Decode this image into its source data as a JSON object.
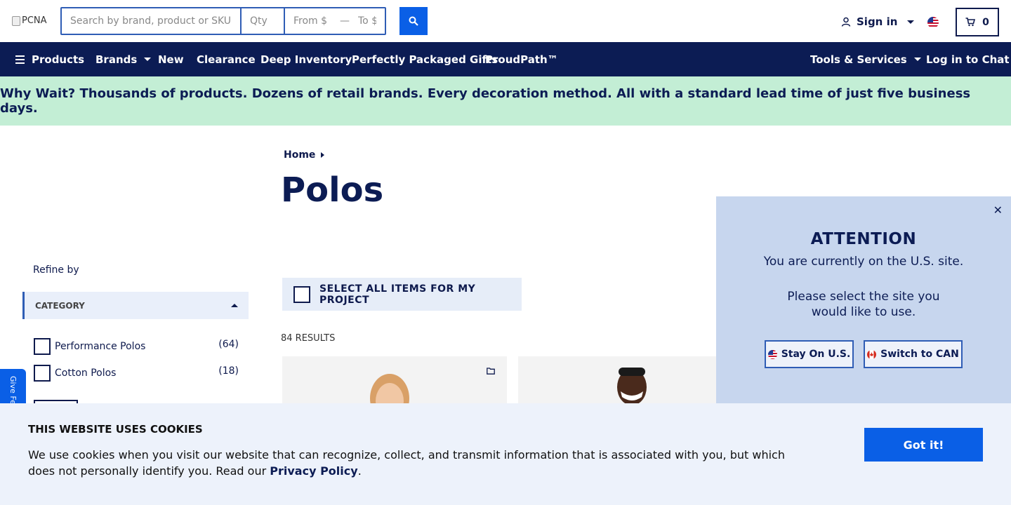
{
  "header": {
    "logo_alt": "PCNA",
    "search": {
      "placeholder": "Search by brand, product or SKU",
      "qty_placeholder": "Qty",
      "from_placeholder": "From $",
      "to_placeholder": "To $"
    },
    "signin_label": "Sign in",
    "cart_count": "0"
  },
  "nav": {
    "products": "Products",
    "brands": "Brands",
    "new": "New",
    "clearance": "Clearance",
    "deep_inventory": "Deep Inventory",
    "gifts": "Perfectly Packaged Gifts",
    "proudpath": "ProudPath™",
    "tools": "Tools & Services",
    "chat": "Log in to Chat"
  },
  "banner": {
    "text": "Why Wait? Thousands of products. Dozens of retail brands. Every decoration method. All with a standard lead time of just five business days."
  },
  "breadcrumb": {
    "home": "Home"
  },
  "page": {
    "title": "Polos",
    "results": "84 RESULTS",
    "select_all": "SELECT ALL ITEMS FOR MY PROJECT"
  },
  "filters": {
    "refine_label": "Refine by",
    "category_label": "CATEGORY",
    "items": [
      {
        "label": "Performance Polos",
        "count": "(64)"
      },
      {
        "label": "Cotton Polos",
        "count": "(18)"
      }
    ]
  },
  "feedback": {
    "label": "Give Fe"
  },
  "modal": {
    "title": "ATTENTION",
    "subtitle": "You are currently on the U.S. site.",
    "ask": "Please select the site you would like to use.",
    "stay_label": "Stay On U.S.",
    "switch_label": "Switch to CAN"
  },
  "cookie": {
    "title": "THIS WEBSITE USES COOKIES",
    "text": "We use cookies when you visit our website that can recognize, collect, and transmit information that is associated with you, but which does not personally identify you. Read our",
    "link": "Privacy Policy",
    "tail": ".",
    "button": "Got it!"
  },
  "colors": {
    "navy": "#0c1c54",
    "accent_blue": "#0a5fe6",
    "banner_green": "#c3eed5",
    "modal_bg": "#c7d6ee"
  }
}
